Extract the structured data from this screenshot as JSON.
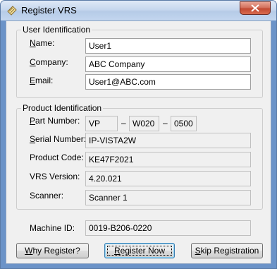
{
  "window": {
    "title": "Register VRS"
  },
  "user_identification": {
    "legend": "User Identification",
    "name": {
      "label_access": "N",
      "label_rest": "ame:",
      "value": "User1"
    },
    "company": {
      "label_access": "C",
      "label_rest": "ompany:",
      "value": "ABC Company"
    },
    "email": {
      "label_access": "E",
      "label_rest": "mail:",
      "value": "User1@ABC.com"
    }
  },
  "product_identification": {
    "legend": "Product Identification",
    "part_number": {
      "label_access": "P",
      "label_rest": "art Number:",
      "seg1": "VP",
      "seg2": "W020",
      "seg3": "0500",
      "separator": "–"
    },
    "serial_number": {
      "label_access": "S",
      "label_rest": "erial Number:",
      "value": "IP-VISTA2W"
    },
    "product_code": {
      "label": "Product Code:",
      "value": "KE47F2021"
    },
    "vrs_version": {
      "label": "VRS Version:",
      "value": "4.20.021"
    },
    "scanner": {
      "label": "Scanner:",
      "value": "Scanner 1"
    }
  },
  "machine_id": {
    "label": "Machine ID:",
    "value": "0019-B206-0220"
  },
  "buttons": {
    "why_register": {
      "access": "W",
      "rest": "hy Register?"
    },
    "register_now": {
      "access": "R",
      "rest": "egister Now"
    },
    "skip_registration": {
      "access": "S",
      "rest": "kip Registration"
    }
  },
  "icons": {
    "title_icon": "app-icon",
    "close": "close-icon"
  },
  "colors": {
    "close_button": "#c24a33",
    "window_frame": "#6b93c8",
    "client_bg": "#f0f0f0"
  }
}
